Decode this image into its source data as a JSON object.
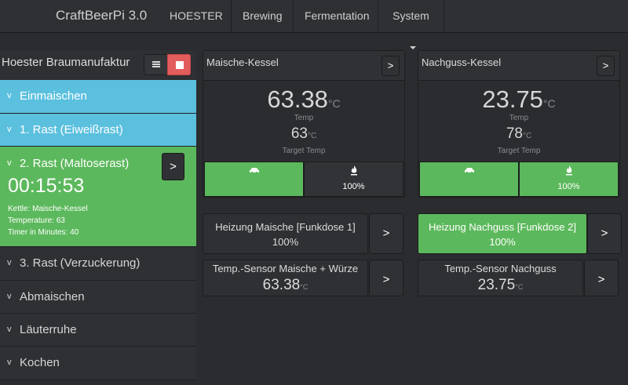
{
  "navbar": {
    "brand": "CraftBeerPi 3.0",
    "items": [
      "HOESTER",
      "Brewing",
      "Fermentation",
      "System"
    ]
  },
  "steps_panel": {
    "title": "Hoester Braumanufaktur",
    "list_icon": "list-icon",
    "stop_icon": "stop-icon",
    "steps": [
      {
        "label": "Einmaischen",
        "state": "done"
      },
      {
        "label": "1. Rast (Eiweißrast)",
        "state": "done"
      },
      {
        "label": "2. Rast (Maltoserast)",
        "state": "active",
        "timer": "00:15:53",
        "props": [
          "Kettle: Maische-Kessel",
          "Temperature: 63",
          "Timer in Minutes: 40"
        ],
        "next": ">"
      },
      {
        "label": "3. Rast (Verzuckerung)",
        "state": "pending"
      },
      {
        "label": "Abmaischen",
        "state": "pending"
      },
      {
        "label": "Läuterruhe",
        "state": "pending"
      },
      {
        "label": "Kochen",
        "state": "pending"
      }
    ],
    "chevron": "v"
  },
  "kettles": [
    {
      "name": "Maische-Kessel",
      "temp": "63.38",
      "unit": "°C",
      "temp_label": "Temp",
      "target": "63",
      "target_unit": "°C",
      "target_label": "Target Temp",
      "agitator_icon": "car-icon",
      "heater_icon": "flame-icon",
      "heater_power": "100%",
      "btn": ">"
    },
    {
      "name": "Nachguss-Kessel",
      "temp": "23.75",
      "unit": "°C",
      "temp_label": "Temp",
      "target": "78",
      "target_unit": "°C",
      "target_label": "Target Temp",
      "agitator_icon": "car-icon",
      "heater_icon": "flame-icon",
      "heater_power": "100%",
      "btn": ">"
    }
  ],
  "actors": [
    {
      "name": "Heizung Maische [Funkdose 1]",
      "power": "100%",
      "state": "off"
    },
    {
      "name": "Heizung Nachguss [Funkdose 2]",
      "power": "100%",
      "state": "on"
    }
  ],
  "sensors": [
    {
      "name": "Temp.-Sensor Maische + Würze",
      "value": "63.38",
      "unit": "°C"
    },
    {
      "name": "Temp.-Sensor Nachguss",
      "value": "23.75",
      "unit": "°C"
    }
  ],
  "chevron_right": ">",
  "colors": {
    "done": "#5bc0de",
    "active": "#5cb85c",
    "stop": "#e35d5d",
    "background": "#2b2c2f"
  }
}
